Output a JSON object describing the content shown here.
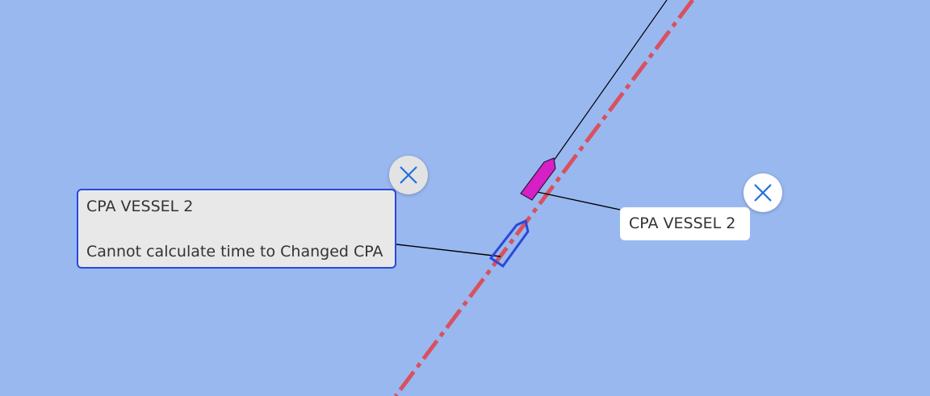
{
  "own_vessel_label": {
    "title": "CPA VESSEL 2",
    "message": "Cannot calculate time to Changed CPA"
  },
  "target_vessel_label": {
    "title": "CPA VESSEL 2"
  },
  "icons": {
    "close": "close-icon",
    "own_ship": "own-ship-icon",
    "target_ship": "target-ship-icon"
  },
  "colors": {
    "sea": "#99b8f0",
    "own_ship": "#2a49d9",
    "target_ship": "#d61fc4",
    "route_line": "#d9515e",
    "close_icon": "#1f6fe0"
  }
}
